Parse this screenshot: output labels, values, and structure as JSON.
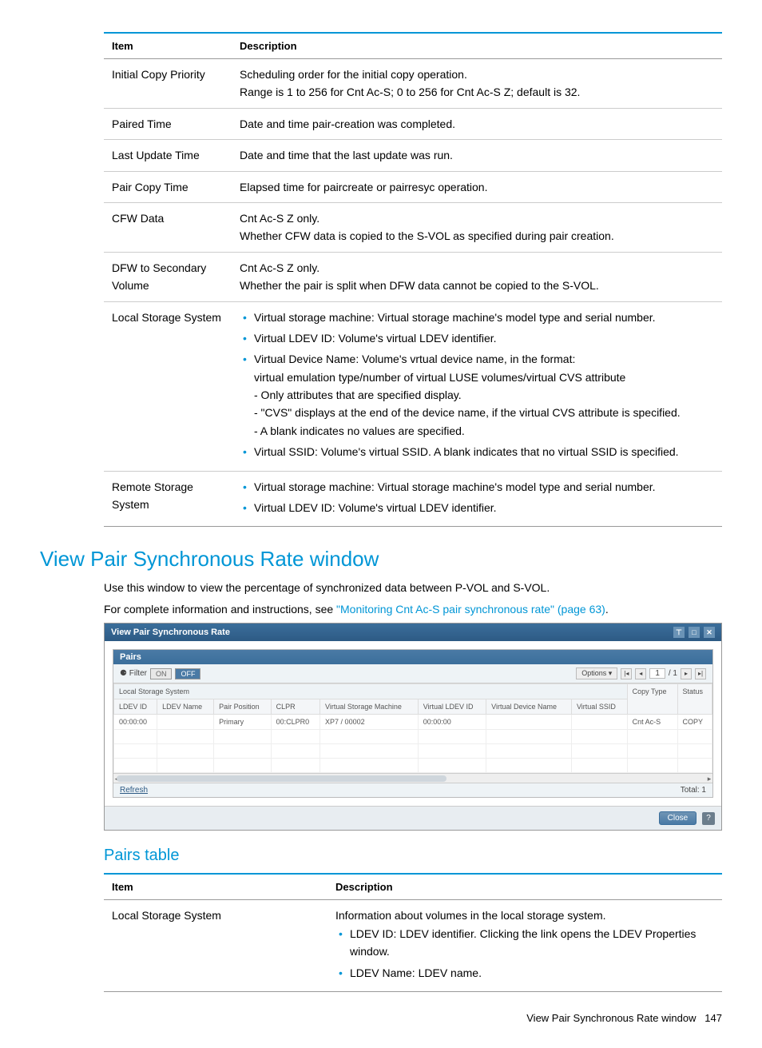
{
  "table1": {
    "head": {
      "item": "Item",
      "desc": "Description"
    },
    "rows": {
      "r0": {
        "item": "Initial Copy Priority",
        "l1": "Scheduling order for the initial copy operation.",
        "l2": "Range is 1 to 256 for Cnt Ac-S; 0 to 256 for Cnt Ac-S Z; default is 32."
      },
      "r1": {
        "item": "Paired Time",
        "desc": "Date and time pair-creation was completed."
      },
      "r2": {
        "item": "Last Update Time",
        "desc": "Date and time that the last update was run."
      },
      "r3": {
        "item": "Pair Copy Time",
        "desc": "Elapsed time for paircreate or pairresyc operation."
      },
      "r4": {
        "item": "CFW Data",
        "l1": "Cnt Ac-S Z only.",
        "l2": "Whether CFW data is copied to the S-VOL as specified during pair creation."
      },
      "r5": {
        "item": "DFW to Secondary Volume",
        "l1": "Cnt Ac-S Z only.",
        "l2": "Whether the pair is split when DFW data cannot be copied to the S-VOL."
      },
      "r6": {
        "item": "Local Storage System",
        "b1": "Virtual storage machine: Virtual storage machine's model type and serial number.",
        "b2": "Virtual LDEV ID: Volume's virtual LDEV identifier.",
        "b3": "Virtual Device Name: Volume's vrtual device name, in the format:",
        "b3a": "virtual emulation type/number of virtual LUSE volumes/virtual CVS attribute",
        "b3b": "- Only attributes that are specified display.",
        "b3c": "- \"CVS\" displays at the end of the device name, if the virtual CVS attribute is specified.",
        "b3d": "- A blank indicates no values are specified.",
        "b4": "Virtual SSID: Volume's virtual SSID. A blank indicates that no virtual SSID is specified."
      },
      "r7": {
        "item": "Remote Storage System",
        "b1": "Virtual storage machine: Virtual storage machine's model type and serial number.",
        "b2": "Virtual LDEV ID: Volume's virtual LDEV identifier."
      }
    }
  },
  "section": {
    "h2": "View Pair Synchronous Rate window",
    "p1": "Use this window to view the percentage of synchronized data between P-VOL and S-VOL.",
    "p2pre": "For complete information and instructions, see ",
    "p2link": "\"Monitoring Cnt Ac-S pair synchronous rate\" (page 63)",
    "p2post": "."
  },
  "shot": {
    "title": "View Pair Synchronous Rate",
    "pairs_label": "Pairs",
    "filter_label": "⚈ Filter",
    "on": "ON",
    "off": "OFF",
    "options": "Options ▾",
    "page_cur": "1",
    "page_sep": "/ 1",
    "group_header": "Local Storage System",
    "cols": {
      "c0": "LDEV ID",
      "c1": "LDEV Name",
      "c2": "Pair Position",
      "c3": "CLPR",
      "c4": "Virtual Storage Machine",
      "c5": "Virtual LDEV ID",
      "c6": "Virtual Device Name",
      "c7": "Virtual SSID",
      "c8": "Copy Type",
      "c9": "Status"
    },
    "row": {
      "c0": "00:00:00",
      "c1": "",
      "c2": "Primary",
      "c3": "00:CLPR0",
      "c4": "XP7 / 00002",
      "c5": "00:00:00",
      "c6": "",
      "c7": "",
      "c8": "Cnt Ac-S",
      "c9": "COPY"
    },
    "refresh": "Refresh",
    "total": "Total: 1",
    "close": "Close",
    "help": "?"
  },
  "h3": "Pairs table",
  "table2": {
    "head": {
      "item": "Item",
      "desc": "Description"
    },
    "rows": {
      "r0": {
        "item": "Local Storage System",
        "l1": "Information about volumes in the local storage system.",
        "b1": "LDEV ID: LDEV identifier. Clicking the link opens the LDEV Properties window.",
        "b2": "LDEV Name: LDEV name."
      }
    }
  },
  "footer": {
    "text": "View Pair Synchronous Rate window",
    "page": "147"
  }
}
